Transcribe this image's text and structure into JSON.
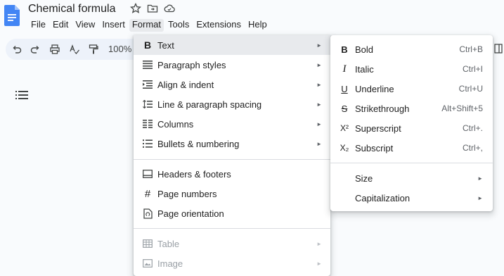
{
  "document": {
    "title": "Chemical formula"
  },
  "menubar": {
    "items": [
      "File",
      "Edit",
      "View",
      "Insert",
      "Format",
      "Tools",
      "Extensions",
      "Help"
    ]
  },
  "toolbar": {
    "zoom": "100%"
  },
  "format_menu": {
    "items": [
      {
        "label": "Text",
        "icon": "bold-icon",
        "has_submenu": true,
        "highlighted": true
      },
      {
        "label": "Paragraph styles",
        "icon": "paragraph-styles-icon",
        "has_submenu": true
      },
      {
        "label": "Align & indent",
        "icon": "align-indent-icon",
        "has_submenu": true
      },
      {
        "label": "Line & paragraph spacing",
        "icon": "line-spacing-icon",
        "has_submenu": true
      },
      {
        "label": "Columns",
        "icon": "columns-icon",
        "has_submenu": true
      },
      {
        "label": "Bullets & numbering",
        "icon": "bullets-icon",
        "has_submenu": true
      },
      {
        "label": "Headers & footers",
        "icon": "headers-footers-icon",
        "has_submenu": false
      },
      {
        "label": "Page numbers",
        "icon": "hash-icon",
        "has_submenu": false
      },
      {
        "label": "Page orientation",
        "icon": "page-orientation-icon",
        "has_submenu": false
      },
      {
        "label": "Table",
        "icon": "table-icon",
        "has_submenu": true,
        "disabled": true
      },
      {
        "label": "Image",
        "icon": "image-icon",
        "has_submenu": true,
        "disabled": true
      }
    ]
  },
  "text_submenu": {
    "items": [
      {
        "label": "Bold",
        "icon_glyph": "B",
        "shortcut": "Ctrl+B"
      },
      {
        "label": "Italic",
        "icon_glyph": "I",
        "shortcut": "Ctrl+I"
      },
      {
        "label": "Underline",
        "icon_glyph": "U",
        "shortcut": "Ctrl+U"
      },
      {
        "label": "Strikethrough",
        "icon_glyph": "S",
        "shortcut": "Alt+Shift+5"
      },
      {
        "label": "Superscript",
        "icon_glyph": "X²",
        "shortcut": "Ctrl+."
      },
      {
        "label": "Subscript",
        "icon_glyph": "X₂",
        "shortcut": "Ctrl+,"
      },
      {
        "label": "Size"
      },
      {
        "label": "Capitalization"
      }
    ]
  },
  "colors": {
    "accent": "#1a73e8",
    "menu_highlight": "#e8eaed",
    "toolbar_bg": "#edf2fa"
  }
}
